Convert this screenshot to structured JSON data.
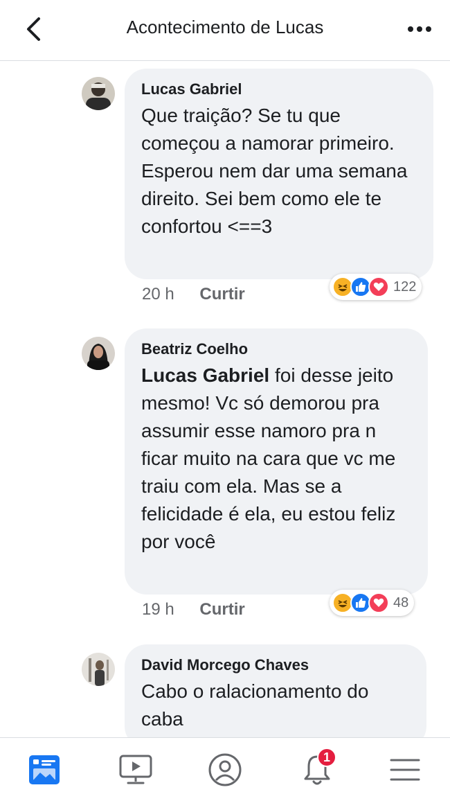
{
  "header": {
    "title": "Acontecimento de Lucas"
  },
  "comments": [
    {
      "author": "Lucas Gabriel",
      "text": "Que traição? Se tu que começou a namorar primeiro. Esperou nem dar uma semana direito. Sei bem como ele te confortou <==3",
      "time": "20 h",
      "like_label": "Curtir",
      "reaction_count": "122",
      "reactions": [
        "haha-icon",
        "like-icon",
        "love-icon"
      ]
    },
    {
      "author": "Beatriz Coelho",
      "mention": "Lucas Gabriel",
      "text": " foi desse jeito mesmo! Vc só demorou pra assumir esse namoro pra n ficar muito na cara que vc me traiu com ela. Mas se a felicidade é ela, eu estou feliz por você",
      "time": "19 h",
      "like_label": "Curtir",
      "reaction_count": "48",
      "reactions": [
        "haha-icon",
        "like-icon",
        "love-icon"
      ]
    },
    {
      "author": "David Morcego Chaves",
      "text": "Cabo o ralacionamento do caba"
    }
  ],
  "tabbar": {
    "items": [
      "news-feed-icon",
      "watch-icon",
      "profile-icon",
      "notifications-icon",
      "menu-icon"
    ],
    "notification_badge": "1"
  },
  "colors": {
    "accent": "#1877f2",
    "bubble": "#f0f2f5",
    "badge": "#e41e3f",
    "love": "#f33e58",
    "haha": "#f7b125"
  }
}
